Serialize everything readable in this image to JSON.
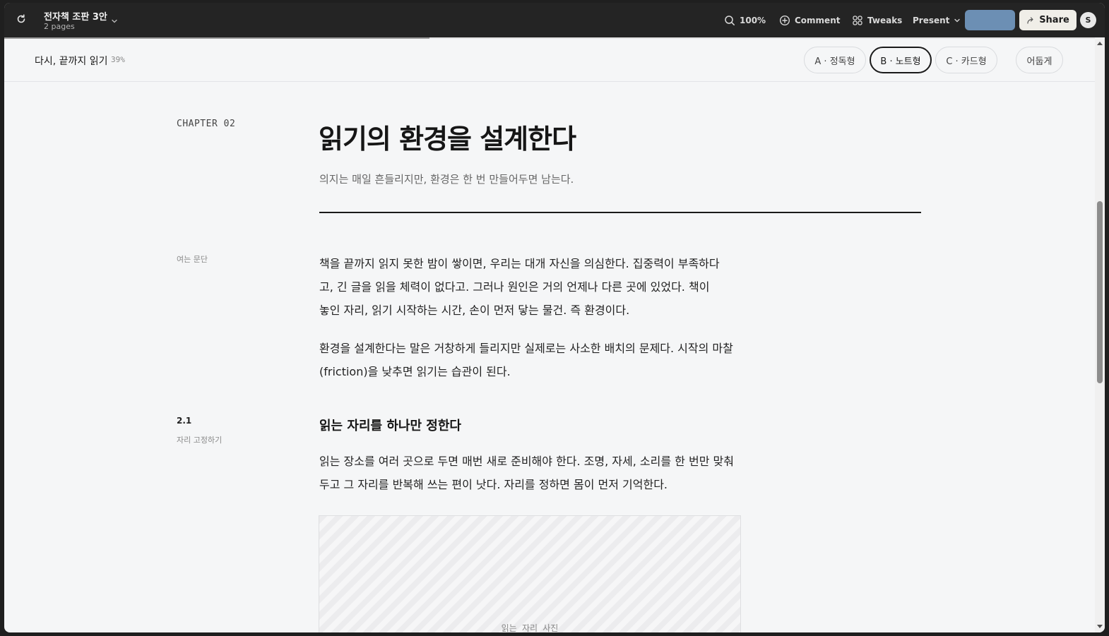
{
  "topbar": {
    "doc_title": "전자책 조판 3안",
    "doc_pages": "2 pages",
    "zoom": "100%",
    "comment_label": "Comment",
    "tweaks_label": "Tweaks",
    "present_label": "Present",
    "share_label": "Share",
    "avatar_initial": "S"
  },
  "reader": {
    "book_title": "다시, 끝까지 읽기",
    "progress_pct": "39%",
    "progress_value": 0.39,
    "layouts": [
      "A · 정독형",
      "B · 노트형",
      "C · 카드형"
    ],
    "active_layout": "B · 노트형",
    "theme_button": "어둡게"
  },
  "chapter": {
    "label": "CHAPTER 02",
    "title": "읽기의 환경을 설계한다",
    "lede": "의지는 매일 흔들리지만, 환경은 한 번 만들어두면 남는다.",
    "opening_label": "여는 문단",
    "paragraphs": [
      "책을 끝까지 읽지 못한 밤이 쌓이면, 우리는 대개 자신을 의심한다. 집중력이 부족하다고, 긴 글을 읽을 체력이 없다고. 그러나 원인은 거의 언제나 다른 곳에 있었다. 책이 놓인 자리, 읽기 시작하는 시간, 손이 먼저 닿는 물건. 즉 환경이다.",
      "환경을 설계한다는 말은 거창하게 들리지만 실제로는 사소한 배치의 문제다. 시작의 마찰(friction)을 낮추면 읽기는 습관이 된다."
    ],
    "section": {
      "number": "2.1",
      "note": "자리 고정하기",
      "heading": "읽는 자리를 하나만 정한다",
      "body": "읽는 장소를 여러 곳으로 두면 매번 새로 준비해야 한다. 조명, 자세, 소리를 한 번만 맞춰두고 그 자리를 반복해 쓰는 편이 낫다. 자리를 정하면 몸이 먼저 기억한다.",
      "image_caption": "읽는 자리 사진"
    }
  }
}
